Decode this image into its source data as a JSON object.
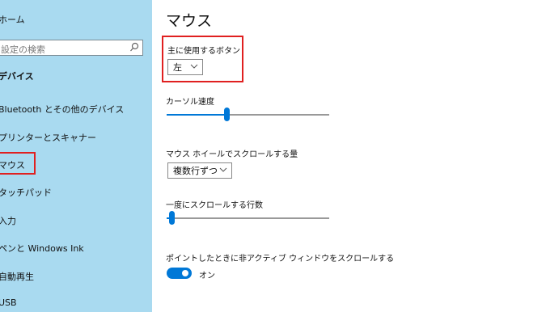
{
  "sidebar": {
    "home": "ホーム",
    "search_placeholder": "設定の検索",
    "section": "デバイス",
    "items": [
      {
        "label": "Bluetooth とその他のデバイス"
      },
      {
        "label": "プリンターとスキャナー"
      },
      {
        "label": "マウス"
      },
      {
        "label": "タッチパッド"
      },
      {
        "label": "入力"
      },
      {
        "label": "ペンと Windows Ink"
      },
      {
        "label": "自動再生"
      },
      {
        "label": "USB"
      }
    ]
  },
  "main": {
    "title": "マウス",
    "primary_button": {
      "label": "主に使用するボタン",
      "value": "左"
    },
    "cursor_speed": {
      "label": "カーソル速度",
      "value_percent": 37
    },
    "wheel_scroll": {
      "label": "マウス ホイールでスクロールする量",
      "value": "複数行ずつ"
    },
    "lines_to_scroll": {
      "label": "一度にスクロールする行数",
      "value_percent": 3
    },
    "inactive_scroll": {
      "label": "ポイントしたときに非アクティブ ウィンドウをスクロールする",
      "state": "オン"
    }
  },
  "colors": {
    "accent": "#0078d7",
    "sidebar_bg": "#a9daf0",
    "highlight": "#e02020"
  }
}
